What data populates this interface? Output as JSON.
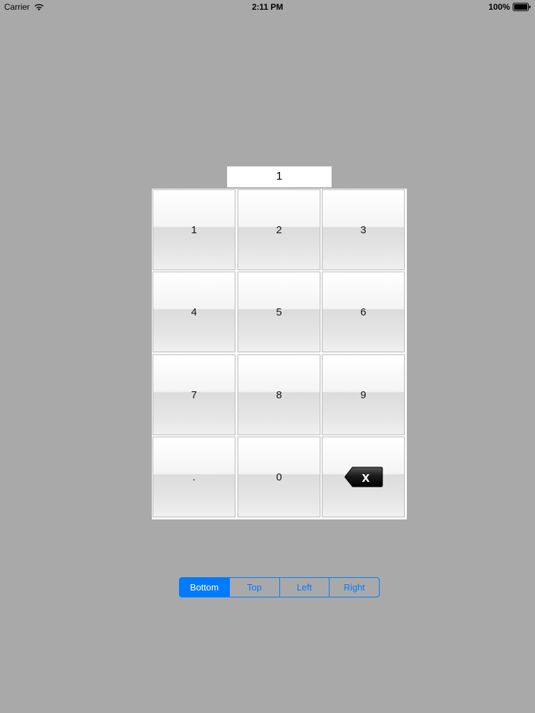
{
  "status_bar": {
    "carrier": "Carrier",
    "time": "2:11 PM",
    "battery_percent": "100%"
  },
  "display": {
    "value": "1"
  },
  "keypad": {
    "keys": [
      "1",
      "2",
      "3",
      "4",
      "5",
      "6",
      "7",
      "8",
      "9",
      ".",
      "0"
    ],
    "backspace_icon": "backspace-icon",
    "backspace_glyph": "x"
  },
  "segmented_control": {
    "segments": [
      "Bottom",
      "Top",
      "Left",
      "Right"
    ],
    "selected": "Bottom"
  },
  "colors": {
    "background": "#a9a9a9",
    "accent": "#007aff"
  }
}
